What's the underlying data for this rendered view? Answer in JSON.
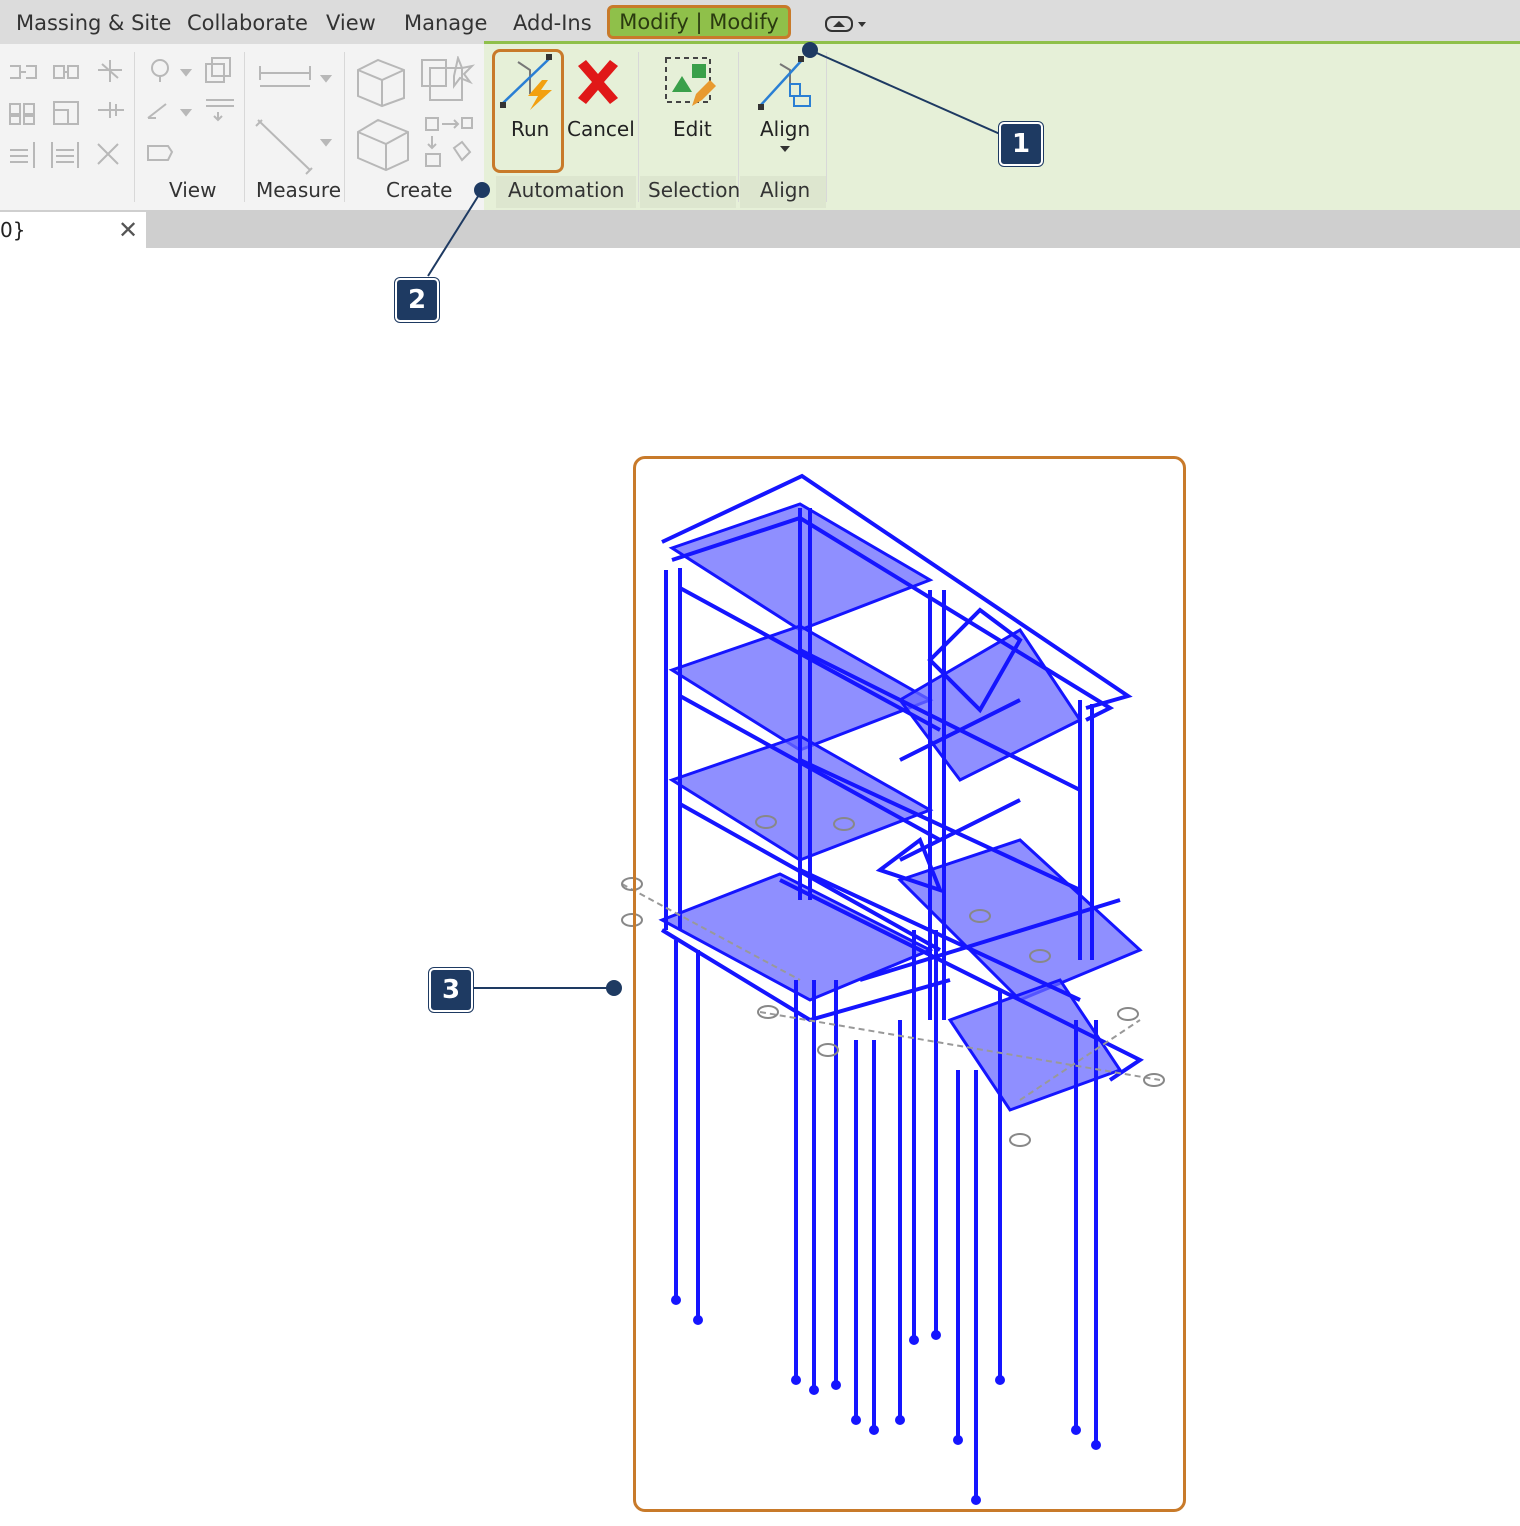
{
  "menu": {
    "tabs": [
      "Massing & Site",
      "Collaborate",
      "View",
      "Manage",
      "Add-Ins"
    ],
    "active_tab": "Modify | Modify"
  },
  "ribbon": {
    "panels": {
      "view": "View",
      "measure": "Measure",
      "create": "Create",
      "automation": "Automation",
      "selection": "Selection",
      "align": "Align"
    },
    "buttons": {
      "run": "Run",
      "cancel": "Cancel",
      "edit": "Edit",
      "align": "Align"
    }
  },
  "view_tab": {
    "label": "0}",
    "close": "✕"
  },
  "callouts": [
    "1",
    "2",
    "3"
  ],
  "colors": {
    "model": "#2020ff",
    "highlight": "#c87a2a",
    "active_tab": "#8fc04a",
    "badge": "#1e3a62"
  }
}
